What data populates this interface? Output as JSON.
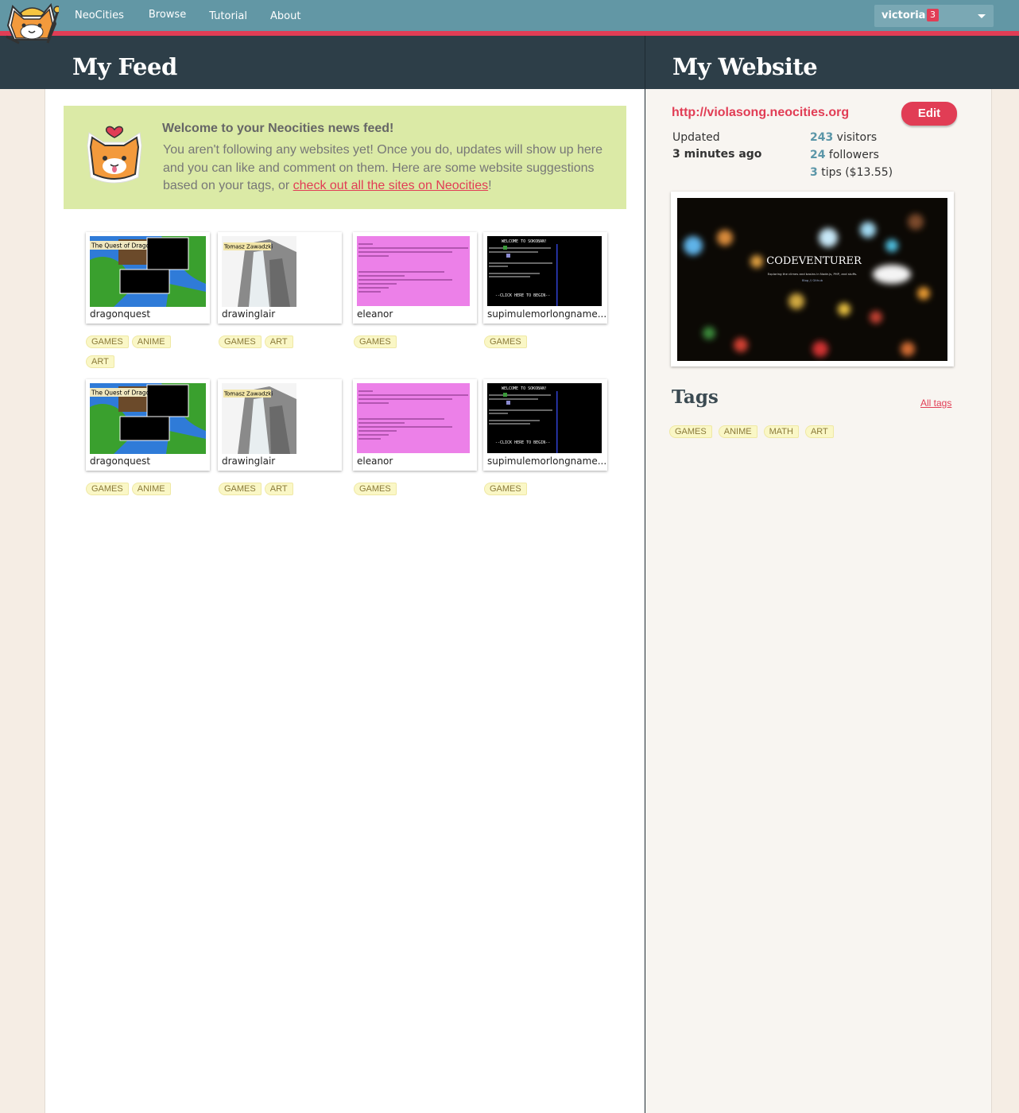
{
  "nav": {
    "links": [
      "NeoCities",
      "Browse",
      "Tutorial",
      "About"
    ],
    "user": "victoria",
    "notifications": "3"
  },
  "headers": {
    "feed": "My Feed",
    "website": "My Website"
  },
  "welcome": {
    "title": "Welcome to your Neocities news feed!",
    "body": "You aren't following any websites yet! Once you do, updates will show up here and you can like and comment on them. Here are some website suggestions based on your tags, or ",
    "link": "check out all the sites on Neocities",
    "end": "!"
  },
  "sites": [
    {
      "name": "dragonquest",
      "tags": [
        "GAMES",
        "ANIME",
        "ART"
      ],
      "thumb": "dragon-quest-screenshot"
    },
    {
      "name": "drawinglair",
      "tags": [
        "GAMES",
        "ART"
      ],
      "thumb": "waterfall-drawing-screenshot"
    },
    {
      "name": "eleanor",
      "tags": [
        "GAMES"
      ],
      "thumb": "pink-page-screenshot"
    },
    {
      "name": "supimulemorlongname...",
      "tags": [
        "GAMES"
      ],
      "thumb": "sokoban-screenshot"
    },
    {
      "name": "dragonquest",
      "tags": [
        "GAMES",
        "ANIME"
      ],
      "thumb": "dragon-quest-screenshot"
    },
    {
      "name": "drawinglair",
      "tags": [
        "GAMES",
        "ART"
      ],
      "thumb": "waterfall-drawing-screenshot"
    },
    {
      "name": "eleanor",
      "tags": [
        "GAMES"
      ],
      "thumb": "pink-page-screenshot"
    },
    {
      "name": "supimulemorlongname...",
      "tags": [
        "GAMES"
      ],
      "thumb": "sokoban-screenshot"
    }
  ],
  "thumb_text": {
    "dragon_title": "The Quest of Dragons",
    "drawing_title": "Tomasz Zawadzki",
    "sokoban_welcome": "WELCOME TO SOKOBAN!",
    "sokoban_click": "--CLICK HERE TO BEGIN--"
  },
  "mysite": {
    "url": "http://violasong.neocities.org",
    "edit": "Edit",
    "updated_label": "Updated",
    "updated_value": "3 minutes ago",
    "visitors_num": "243",
    "visitors_label": " visitors",
    "followers_num": "24",
    "followers_label": " followers",
    "tips_num": "3",
    "tips_label": " tips ($13.55)",
    "shot_title": "CODEVENTURER",
    "shot_sub": "Exploring the climes and basins in Node.js, PHP, and stuffs.",
    "shot_links": "Blog // Github"
  },
  "tags_section": {
    "title": "Tags",
    "all": "All tags",
    "tags": [
      "GAMES",
      "ANIME",
      "MATH",
      "ART"
    ]
  },
  "colors": {
    "accent": "#e13d55",
    "nav": "#6297a5",
    "header": "#2d3e48",
    "welcome_bg": "#dbeaa6"
  }
}
